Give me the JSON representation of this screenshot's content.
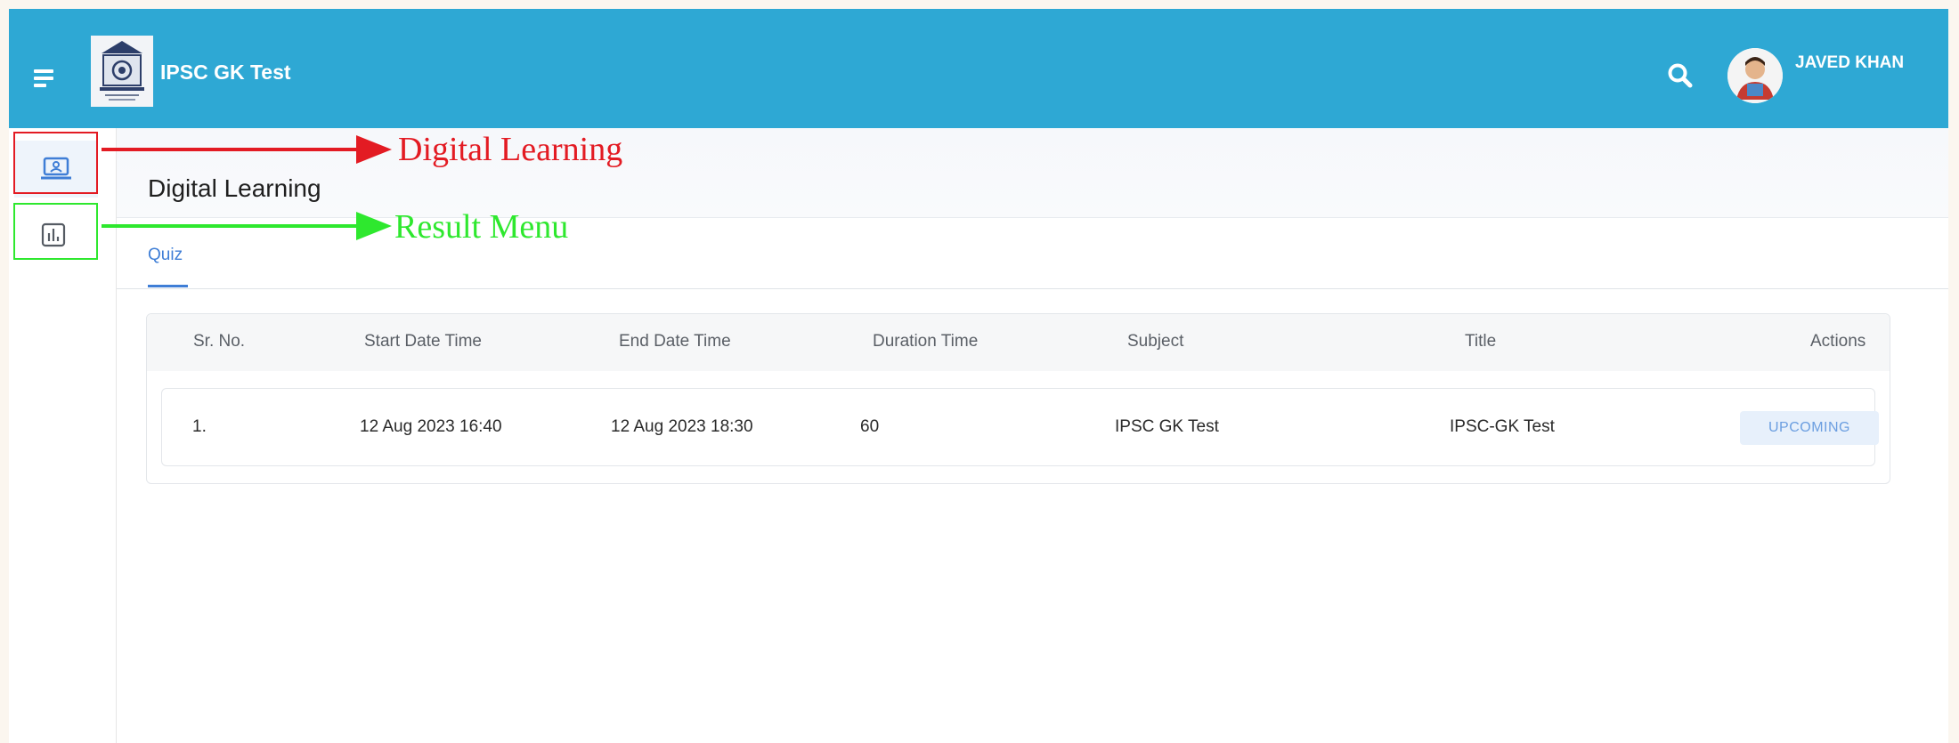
{
  "header": {
    "app_title": "IPSC GK Test",
    "user_name": "JAVED KHAN",
    "color": "#2ea8d4"
  },
  "icons": {
    "menu": "hamburger-menu-icon",
    "logo": "institution-logo",
    "search": "search-icon",
    "avatar": "user-avatar",
    "digital_learning": "laptop-user-icon",
    "result": "bar-chart-icon"
  },
  "page": {
    "title": "Digital Learning"
  },
  "tabs": [
    {
      "label": "Quiz",
      "active": true
    }
  ],
  "table": {
    "columns": [
      "Sr. No.",
      "Start Date Time",
      "End Date Time",
      "Duration Time",
      "Subject",
      "Title",
      "Actions"
    ],
    "rows": [
      {
        "sr_no": "1.",
        "start": "12 Aug 2023 16:40",
        "end": "12 Aug 2023 18:30",
        "duration": "60",
        "subject": "IPSC GK Test",
        "title": "IPSC-GK Test",
        "action": "UPCOMING"
      }
    ]
  },
  "annotations": {
    "digital_learning": "Digital Learning",
    "result_menu": "Result Menu",
    "red": "#e31b23",
    "green": "#2ee82e"
  }
}
